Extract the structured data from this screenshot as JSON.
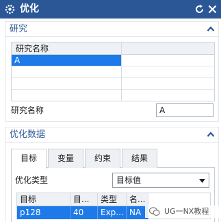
{
  "window": {
    "title": "优化",
    "title_bg": "#2b5797"
  },
  "study": {
    "section_title": "研究",
    "grid_header": "研究名称",
    "rows": [
      "A",
      "",
      "",
      ""
    ],
    "name_label": "研究名称",
    "name_value": "A"
  },
  "optimization": {
    "section_title": "优化数据",
    "tabs": [
      "目标",
      "变量",
      "约束",
      "结果"
    ],
    "active_tab": "目标",
    "type_label": "优化类型",
    "type_value": "目标值",
    "table": {
      "headers": [
        "目标",
        "目...",
        "类型",
        "名..."
      ],
      "row": [
        "p128",
        "40",
        "Exp...",
        "NA"
      ]
    }
  },
  "watermark": {
    "text": "UG一NX教程"
  },
  "colors": {
    "accent": "#2b5797",
    "selection": "#1e7ae8"
  }
}
